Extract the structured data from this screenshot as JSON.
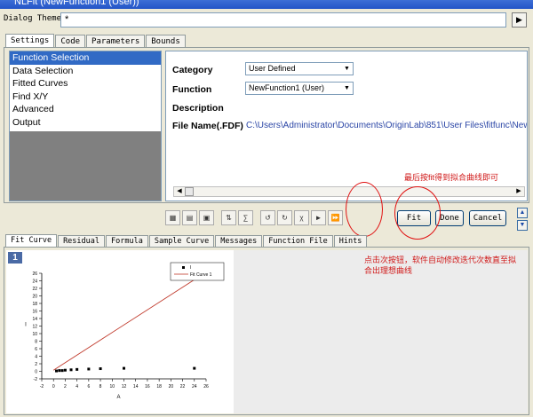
{
  "window": {
    "title": "NLFit (NewFunction1 (User))"
  },
  "theme": {
    "label": "Dialog Theme",
    "value": "*"
  },
  "top_tabs": [
    "Settings",
    "Code",
    "Parameters",
    "Bounds"
  ],
  "tree_items": [
    "Function Selection",
    "Data Selection",
    "Fitted Curves",
    "Find X/Y",
    "Advanced",
    "Output"
  ],
  "settings": {
    "category_label": "Category",
    "category_value": "User Defined",
    "function_label": "Function",
    "function_value": "NewFunction1 (User)",
    "description_label": "Description",
    "filename_label": "File Name(.FDF)",
    "filename_value": "C:\\Users\\Administrator\\Documents\\OriginLab\\851\\User Files\\fitfunc\\NewFunction"
  },
  "buttons": {
    "fit": "Fit",
    "done": "Done",
    "cancel": "Cancel"
  },
  "bottom_tabs": [
    "Fit Curve",
    "Residual",
    "Formula",
    "Sample Curve",
    "Messages",
    "Function File",
    "Hints"
  ],
  "graph": {
    "number": "1"
  },
  "annotations": {
    "top": "最后按fit得到拟合曲线即可",
    "bottom_line1": "点击次按钮，软件自动修改迭代次数直至拟",
    "bottom_line2": "合出理想曲线"
  },
  "chart_data": {
    "type": "scatter",
    "xlabel": "A",
    "ylabel": "I",
    "xlim": [
      -2,
      26
    ],
    "ylim": [
      -2,
      26
    ],
    "xticks": [
      -2,
      0,
      2,
      4,
      6,
      8,
      10,
      12,
      14,
      16,
      18,
      20,
      22,
      24,
      26
    ],
    "yticks": [
      -2,
      0,
      2,
      4,
      6,
      8,
      10,
      12,
      14,
      16,
      18,
      20,
      22,
      24,
      26
    ],
    "series": [
      {
        "name": "I",
        "type": "scatter",
        "x": [
          0.5,
          1,
          1.5,
          2,
          3,
          4,
          6,
          8,
          12,
          24
        ],
        "y": [
          0.1,
          0.2,
          0.2,
          0.3,
          0.4,
          0.5,
          0.6,
          0.7,
          0.8,
          0.8
        ]
      },
      {
        "name": "Fit Curve 1",
        "type": "line",
        "x": [
          0,
          24
        ],
        "y": [
          0.3,
          24.3
        ]
      }
    ],
    "legend": "top-right",
    "colors": {
      "points": "#000000",
      "fit": "#c0392b"
    }
  }
}
